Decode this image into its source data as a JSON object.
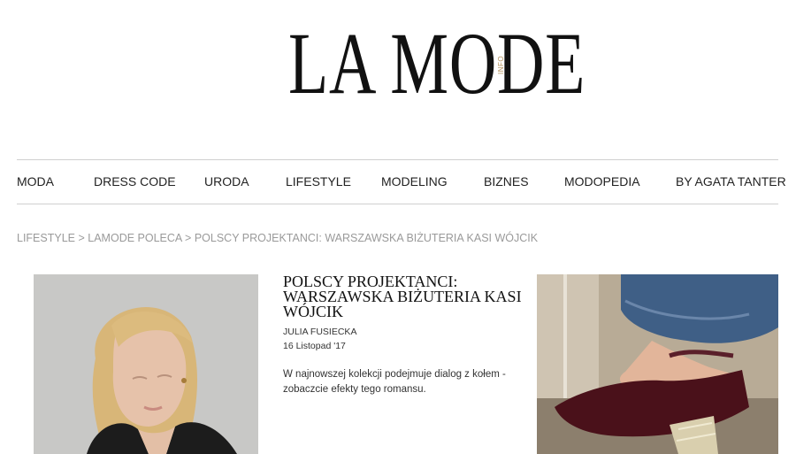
{
  "header": {
    "logo_text": "LA MODE",
    "logo_sup": "INFO"
  },
  "nav": {
    "items": [
      {
        "label": "MODA"
      },
      {
        "label": "DRESS CODE"
      },
      {
        "label": "URODA"
      },
      {
        "label": "LIFESTYLE"
      },
      {
        "label": "MODELING"
      },
      {
        "label": "BIZNES"
      },
      {
        "label": "MODOPEDIA"
      },
      {
        "label": "BY AGATA TANTER"
      }
    ]
  },
  "breadcrumb": {
    "items": [
      "LIFESTYLE",
      "LAMODE POLECA",
      "POLSCY PROJEKTANCI: WARSZAWSKA BIŻUTERIA KASI WÓJCIK"
    ],
    "separator": ">"
  },
  "article": {
    "title": "POLSCY PROJEKTANCI: WARSZAWSKA BIŻUTERIA KASI WÓJCIK",
    "author": "JULIA FUSIECKA",
    "date": "16 Listopad '17",
    "excerpt": "W najnowszej kolekcji podejmuje dialog z kołem - zobaczcie efekty tego romansu."
  },
  "colors": {
    "accent": "#b08d57",
    "breadcrumb": "#9a9a9a",
    "divider": "#cfcfcf"
  }
}
